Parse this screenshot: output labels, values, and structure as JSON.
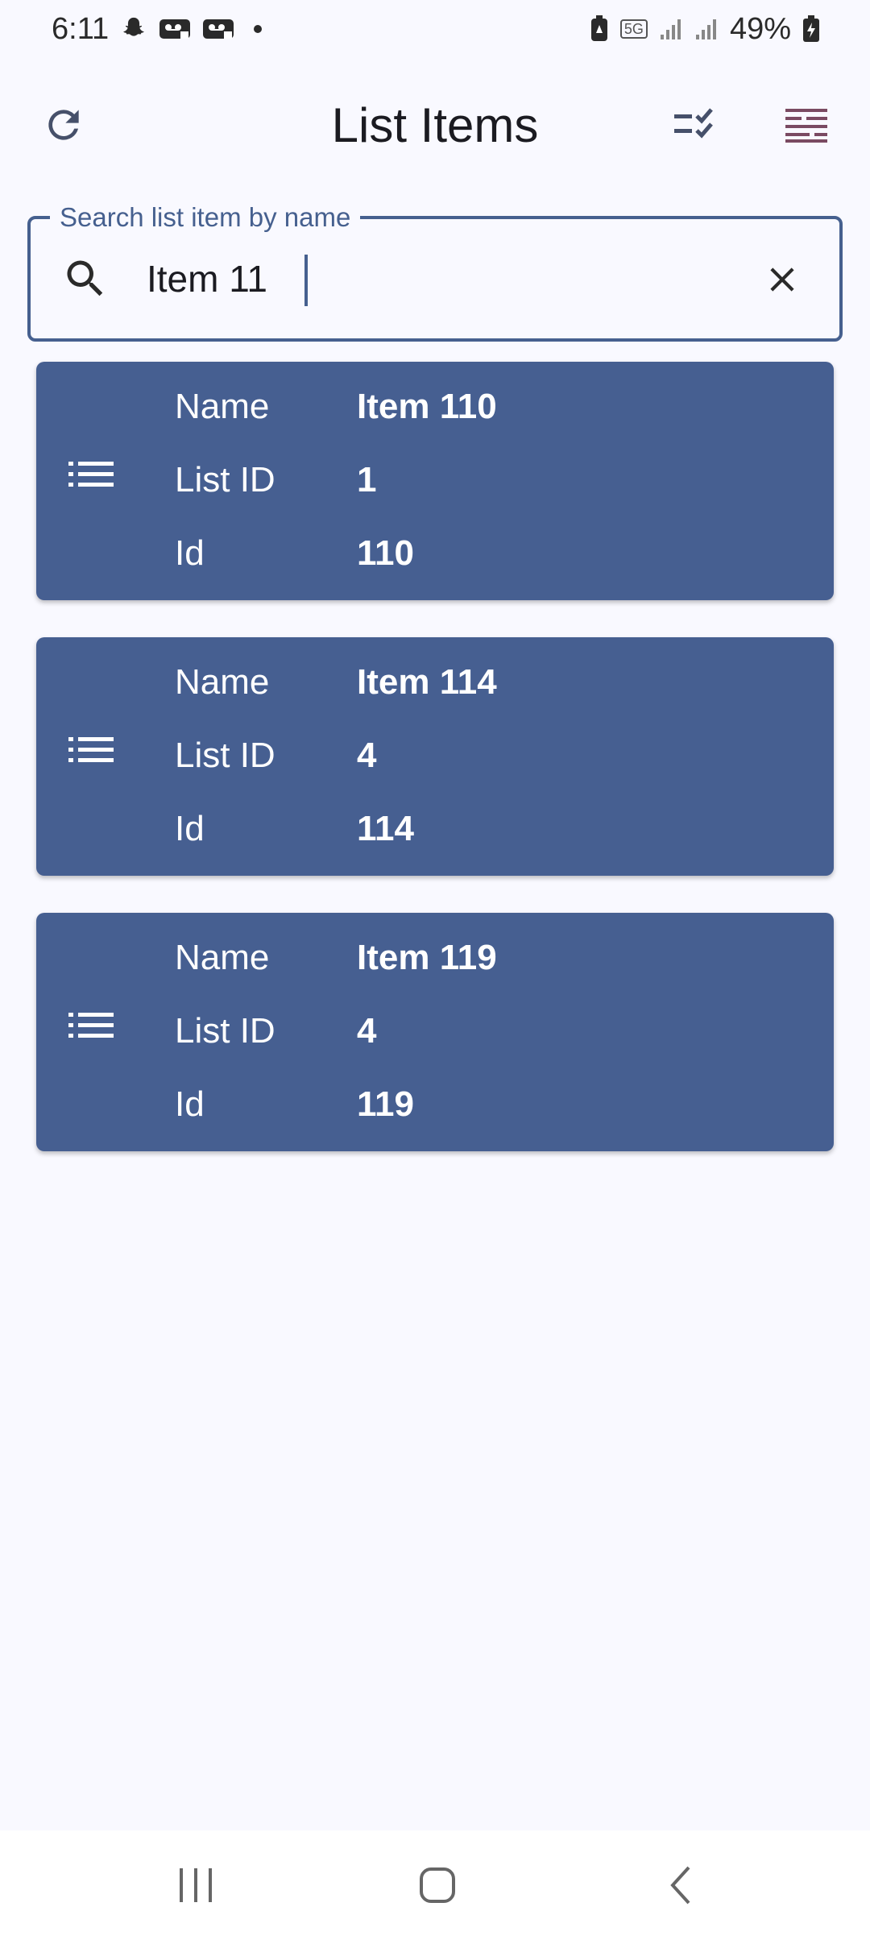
{
  "status_bar": {
    "time": "6:11",
    "network": "5G",
    "battery": "49%"
  },
  "app_bar": {
    "title": "List Items",
    "refresh_icon": "refresh-icon",
    "checklist_icon": "checklist-icon",
    "filter_icon": "filter-lines-icon"
  },
  "search": {
    "label": "Search list item by name",
    "value": "Item 11",
    "placeholder": ""
  },
  "items": [
    {
      "name_label": "Name",
      "name": "Item 110",
      "list_label": "List ID",
      "list_id": "1",
      "id_label": "Id",
      "id": "110"
    },
    {
      "name_label": "Name",
      "name": "Item 114",
      "list_label": "List ID",
      "list_id": "4",
      "id_label": "Id",
      "id": "114"
    },
    {
      "name_label": "Name",
      "name": "Item 119",
      "list_label": "List ID",
      "list_id": "4",
      "id_label": "Id",
      "id": "119"
    }
  ],
  "colors": {
    "primary": "#46608f",
    "card": "#465f91",
    "background": "#f9f9ff",
    "filter_icon": "#7a4a62"
  }
}
